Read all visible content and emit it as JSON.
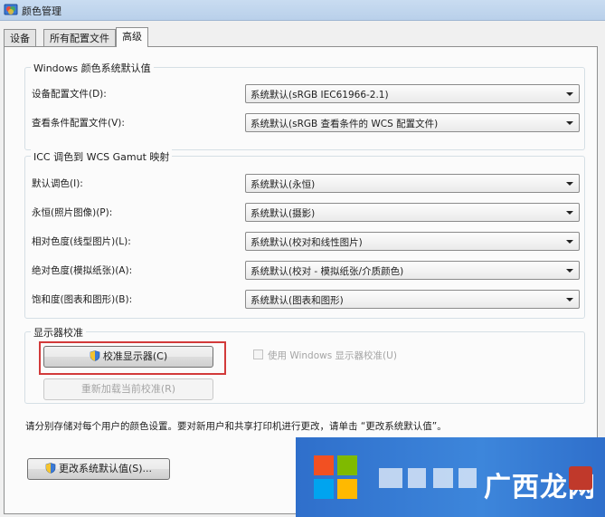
{
  "window": {
    "title": "颜色管理"
  },
  "tabs": [
    {
      "label": "设备"
    },
    {
      "label": "所有配置文件"
    },
    {
      "label": "高级"
    }
  ],
  "active_tab": "高级",
  "windows_defaults": {
    "legend": "Windows 颜色系统默认值",
    "rows": [
      {
        "label": "设备配置文件(D):",
        "value": "系统默认(sRGB IEC61966-2.1)"
      },
      {
        "label": "查看条件配置文件(V):",
        "value": "系统默认(sRGB 查看条件的 WCS 配置文件)"
      }
    ]
  },
  "gamut_mapping": {
    "legend": "ICC 调色到 WCS Gamut 映射",
    "rows": [
      {
        "label": "默认调色(I):",
        "value": "系统默认(永恒)"
      },
      {
        "label": "永恒(照片图像)(P):",
        "value": "系统默认(摄影)"
      },
      {
        "label": "相对色度(线型图片)(L):",
        "value": "系统默认(校对和线性图片)"
      },
      {
        "label": "绝对色度(模拟纸张)(A):",
        "value": "系统默认(校对 - 模拟纸张/介质颜色)"
      },
      {
        "label": "饱和度(图表和图形)(B):",
        "value": "系统默认(图表和图形)"
      }
    ]
  },
  "calibration": {
    "legend": "显示器校准",
    "calibrate_button": "校准显示器(C)",
    "reload_button": "重新加载当前校准(R)",
    "use_windows_calibration": "使用 Windows 显示器校准(U)",
    "use_windows_calibration_checked": false
  },
  "info_text": "请分别存储对每个用户的颜色设置。要对新用户和共享打印机进行更改，请单击 “更改系统默认值”。",
  "change_defaults_button": "更改系统默认值(S)...",
  "watermark": {
    "text": "广西龙网"
  },
  "colors": {
    "highlight": "#d23a3a",
    "titlebar": "#c9dcf1",
    "watermark_blue": "#3d86db"
  }
}
